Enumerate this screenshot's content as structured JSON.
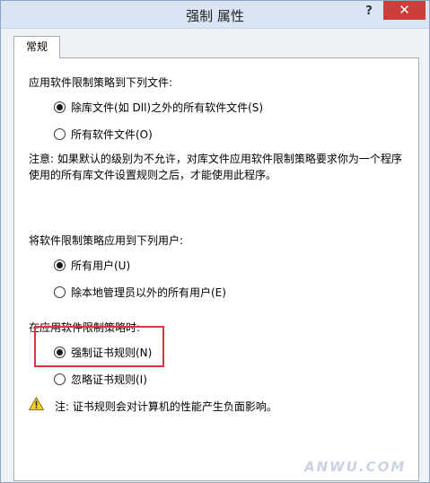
{
  "window": {
    "title": "强制 属性",
    "help_label": "?",
    "close_label": "✕"
  },
  "tabs": [
    {
      "label": "常规",
      "selected": true
    }
  ],
  "section1": {
    "heading": "应用软件限制策略到下列文件:",
    "options": [
      {
        "label": "除库文件(如 Dll)之外的所有软件文件(S)",
        "checked": true
      },
      {
        "label": "所有软件文件(O)",
        "checked": false
      }
    ]
  },
  "note": {
    "line1": "注意: 如果默认的级别为不允许，对库文件应用软件限制策略要求你为一个程序",
    "line2": "使用的所有库文件设置规则之后，才能使用此程序。"
  },
  "section2": {
    "heading": "将软件限制策略应用到下列用户:",
    "options": [
      {
        "label": "所有用户(U)",
        "checked": true
      },
      {
        "label": "除本地管理员以外的所有用户(E)",
        "checked": false
      }
    ]
  },
  "section3": {
    "heading": "在应用软件限制策略时:",
    "options": [
      {
        "label": "强制证书规则(N)",
        "checked": true
      },
      {
        "label": "忽略证书规则(I)",
        "checked": false
      }
    ]
  },
  "warning": {
    "icon": "warning-icon",
    "text": "注: 证书规则会对计算机的性能产生负面影响。"
  },
  "watermark": "ANWU.COM",
  "colors": {
    "highlight": "#d9363e",
    "close_button": "#c7403a",
    "titlebar": "#d9e5f3"
  }
}
